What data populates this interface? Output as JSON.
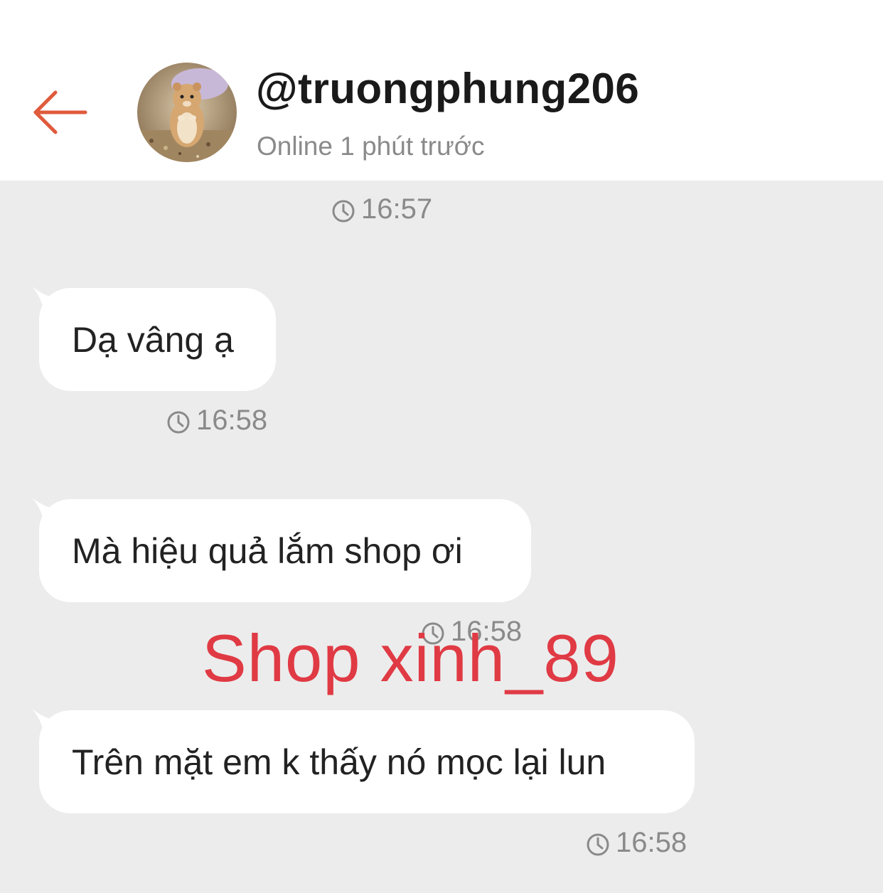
{
  "header": {
    "username": "@truongphung206",
    "status": "Online 1 phút trước"
  },
  "messages": [
    {
      "time": "16:57"
    },
    {
      "text": "Dạ vâng ạ",
      "time": "16:58"
    },
    {
      "text": "Mà hiệu quả lắm shop ơi",
      "time": "16:58"
    },
    {
      "text": "Trên mặt em k thấy nó mọc lại lun",
      "time": "16:58"
    }
  ],
  "watermark": "Shop xinh_89",
  "colors": {
    "accent": "#e05a3c",
    "watermark": "#e03a44",
    "chat_background": "#ececec",
    "bubble": "#ffffff"
  },
  "icons": {
    "back": "arrow-left-icon",
    "time": "clock-icon"
  }
}
